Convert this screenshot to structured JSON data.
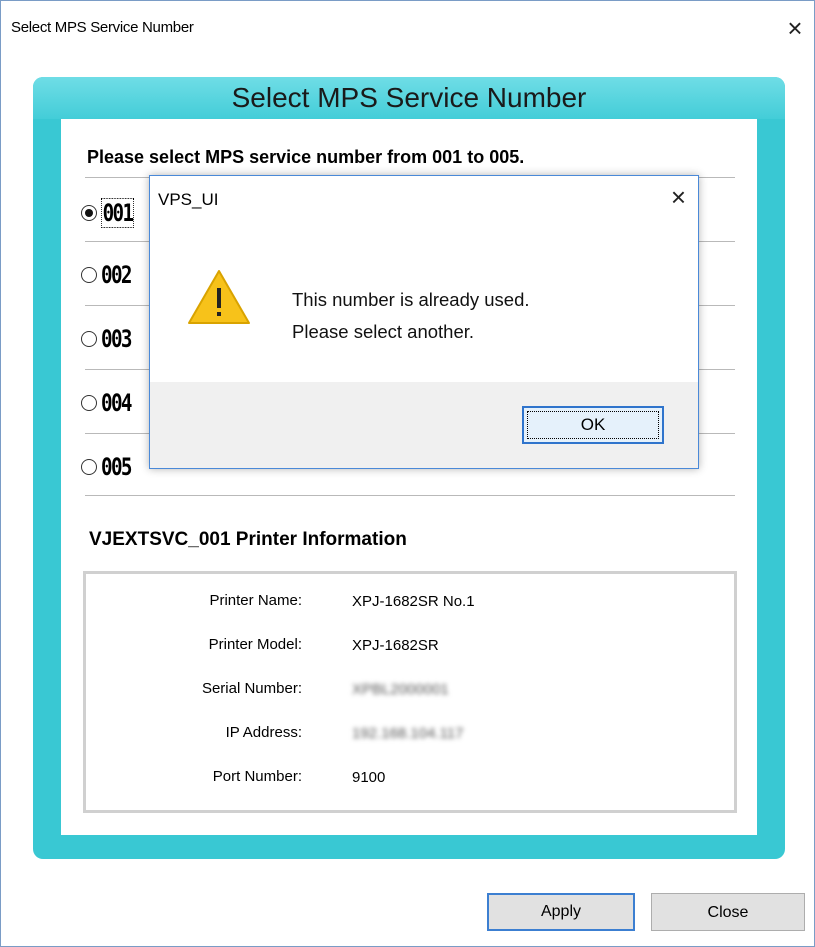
{
  "window": {
    "title": "Select MPS Service Number",
    "close_icon": "×"
  },
  "panel": {
    "header": "Select MPS Service Number",
    "prompt": "Please select MPS service number from 001 to 005.",
    "options": [
      {
        "label": "001",
        "selected": true
      },
      {
        "label": "002",
        "selected": false
      },
      {
        "label": "003",
        "selected": false
      },
      {
        "label": "004",
        "selected": false
      },
      {
        "label": "005",
        "selected": false
      }
    ],
    "info_heading": "VJEXTSVC_001 Printer Information",
    "info": [
      {
        "label": "Printer Name:",
        "value": "XPJ-1682SR No.1",
        "blurred": false
      },
      {
        "label": "Printer Model:",
        "value": "XPJ-1682SR",
        "blurred": false
      },
      {
        "label": "Serial Number:",
        "value": "XPBL2000001",
        "blurred": true
      },
      {
        "label": "IP Address:",
        "value": "192.168.104.117",
        "blurred": true
      },
      {
        "label": "Port Number:",
        "value": "9100",
        "blurred": false
      }
    ]
  },
  "buttons": {
    "apply": "Apply",
    "close": "Close"
  },
  "dialog": {
    "title": "VPS_UI",
    "close_icon": "×",
    "message_line1": "This number is already used.",
    "message_line2": "Please select another.",
    "ok": "OK",
    "icon": "warning-icon"
  },
  "colors": {
    "panel": "#39c8d3",
    "dialog_border": "#4a89d8",
    "warning": "#f7c21a"
  }
}
